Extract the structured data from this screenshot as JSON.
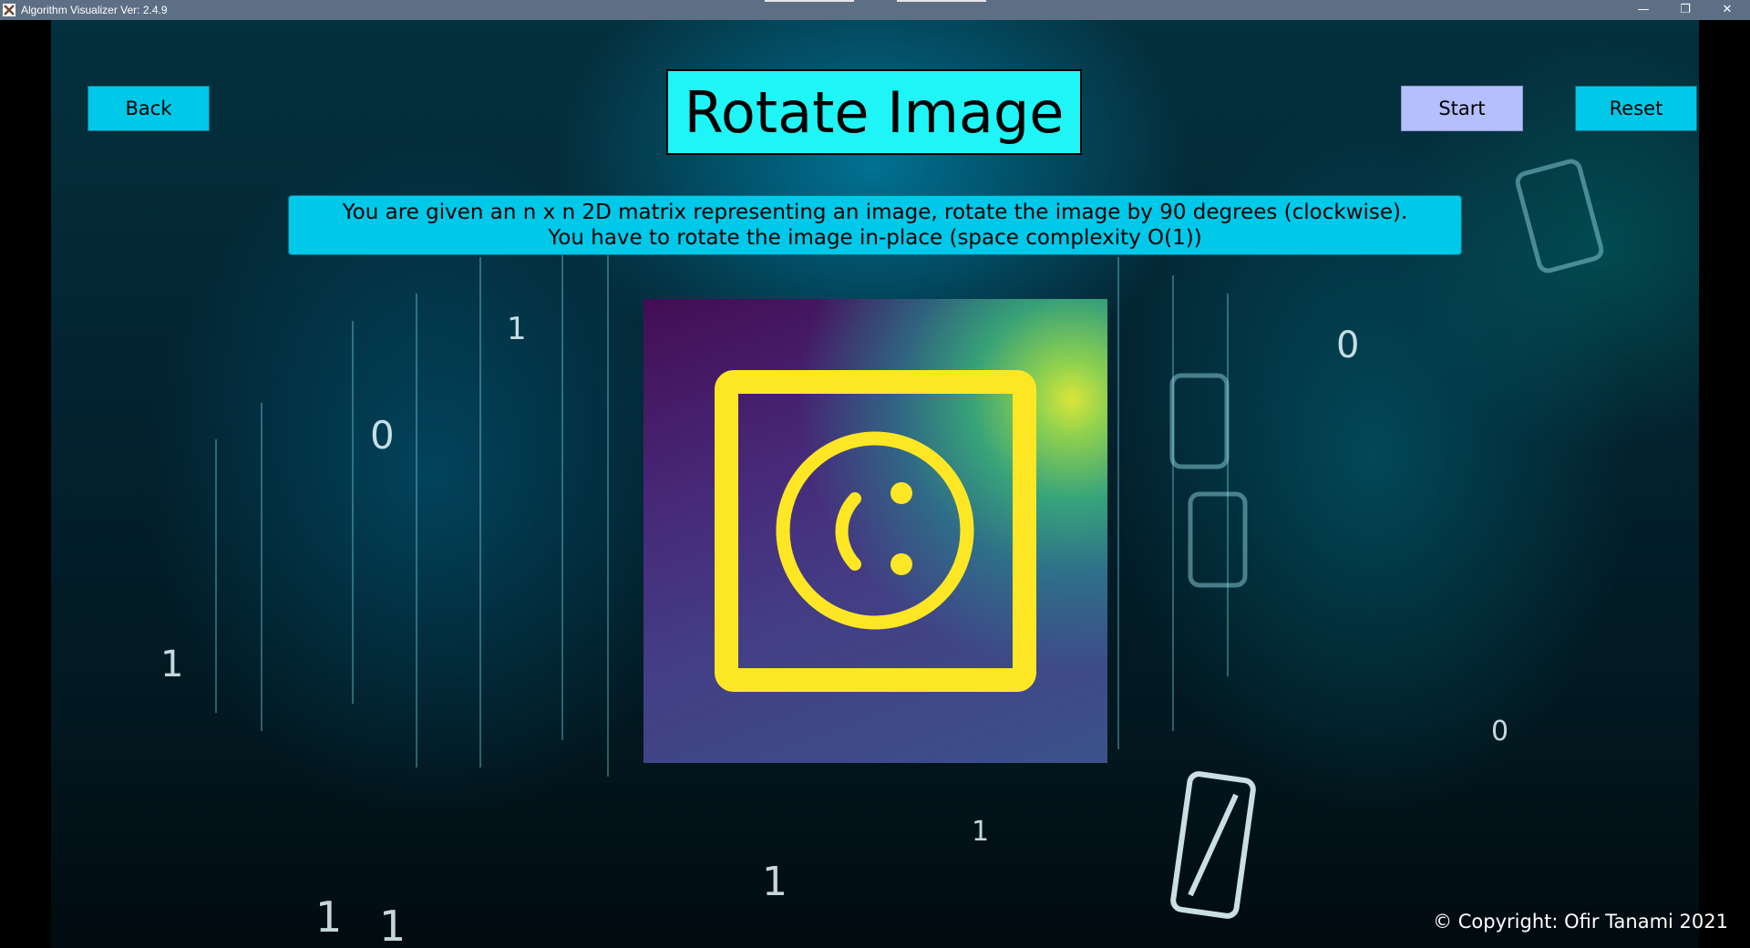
{
  "window": {
    "title": "Algorithm Visualizer Ver: 2.4.9",
    "minimize_glyph": "—",
    "restore_glyph": "❐",
    "close_glyph": "✕"
  },
  "header": {
    "back_label": "Back",
    "title": "Rotate Image",
    "start_label": "Start",
    "reset_label": "Reset"
  },
  "description": {
    "line1": "You are given an n x n 2D matrix representing an image, rotate the image by 90 degrees (clockwise).",
    "line2": "You have to rotate the image in-place (space complexity O(1))"
  },
  "image": {
    "icon": "smiley-face-rotated-icon",
    "colors": {
      "frame": "#fde725",
      "face": "#fde725",
      "gradient_dark": "#440d54",
      "gradient_mid": "#3b528b",
      "gradient_light": "#d9e63a"
    }
  },
  "footer": {
    "copyright": "© Copyright: Ofir Tanami 2021"
  },
  "colors": {
    "titlebar": "#5d6f84",
    "button": "#00c8e8",
    "start_button": "#b3bfff",
    "title_box": "#1ff4f6"
  }
}
